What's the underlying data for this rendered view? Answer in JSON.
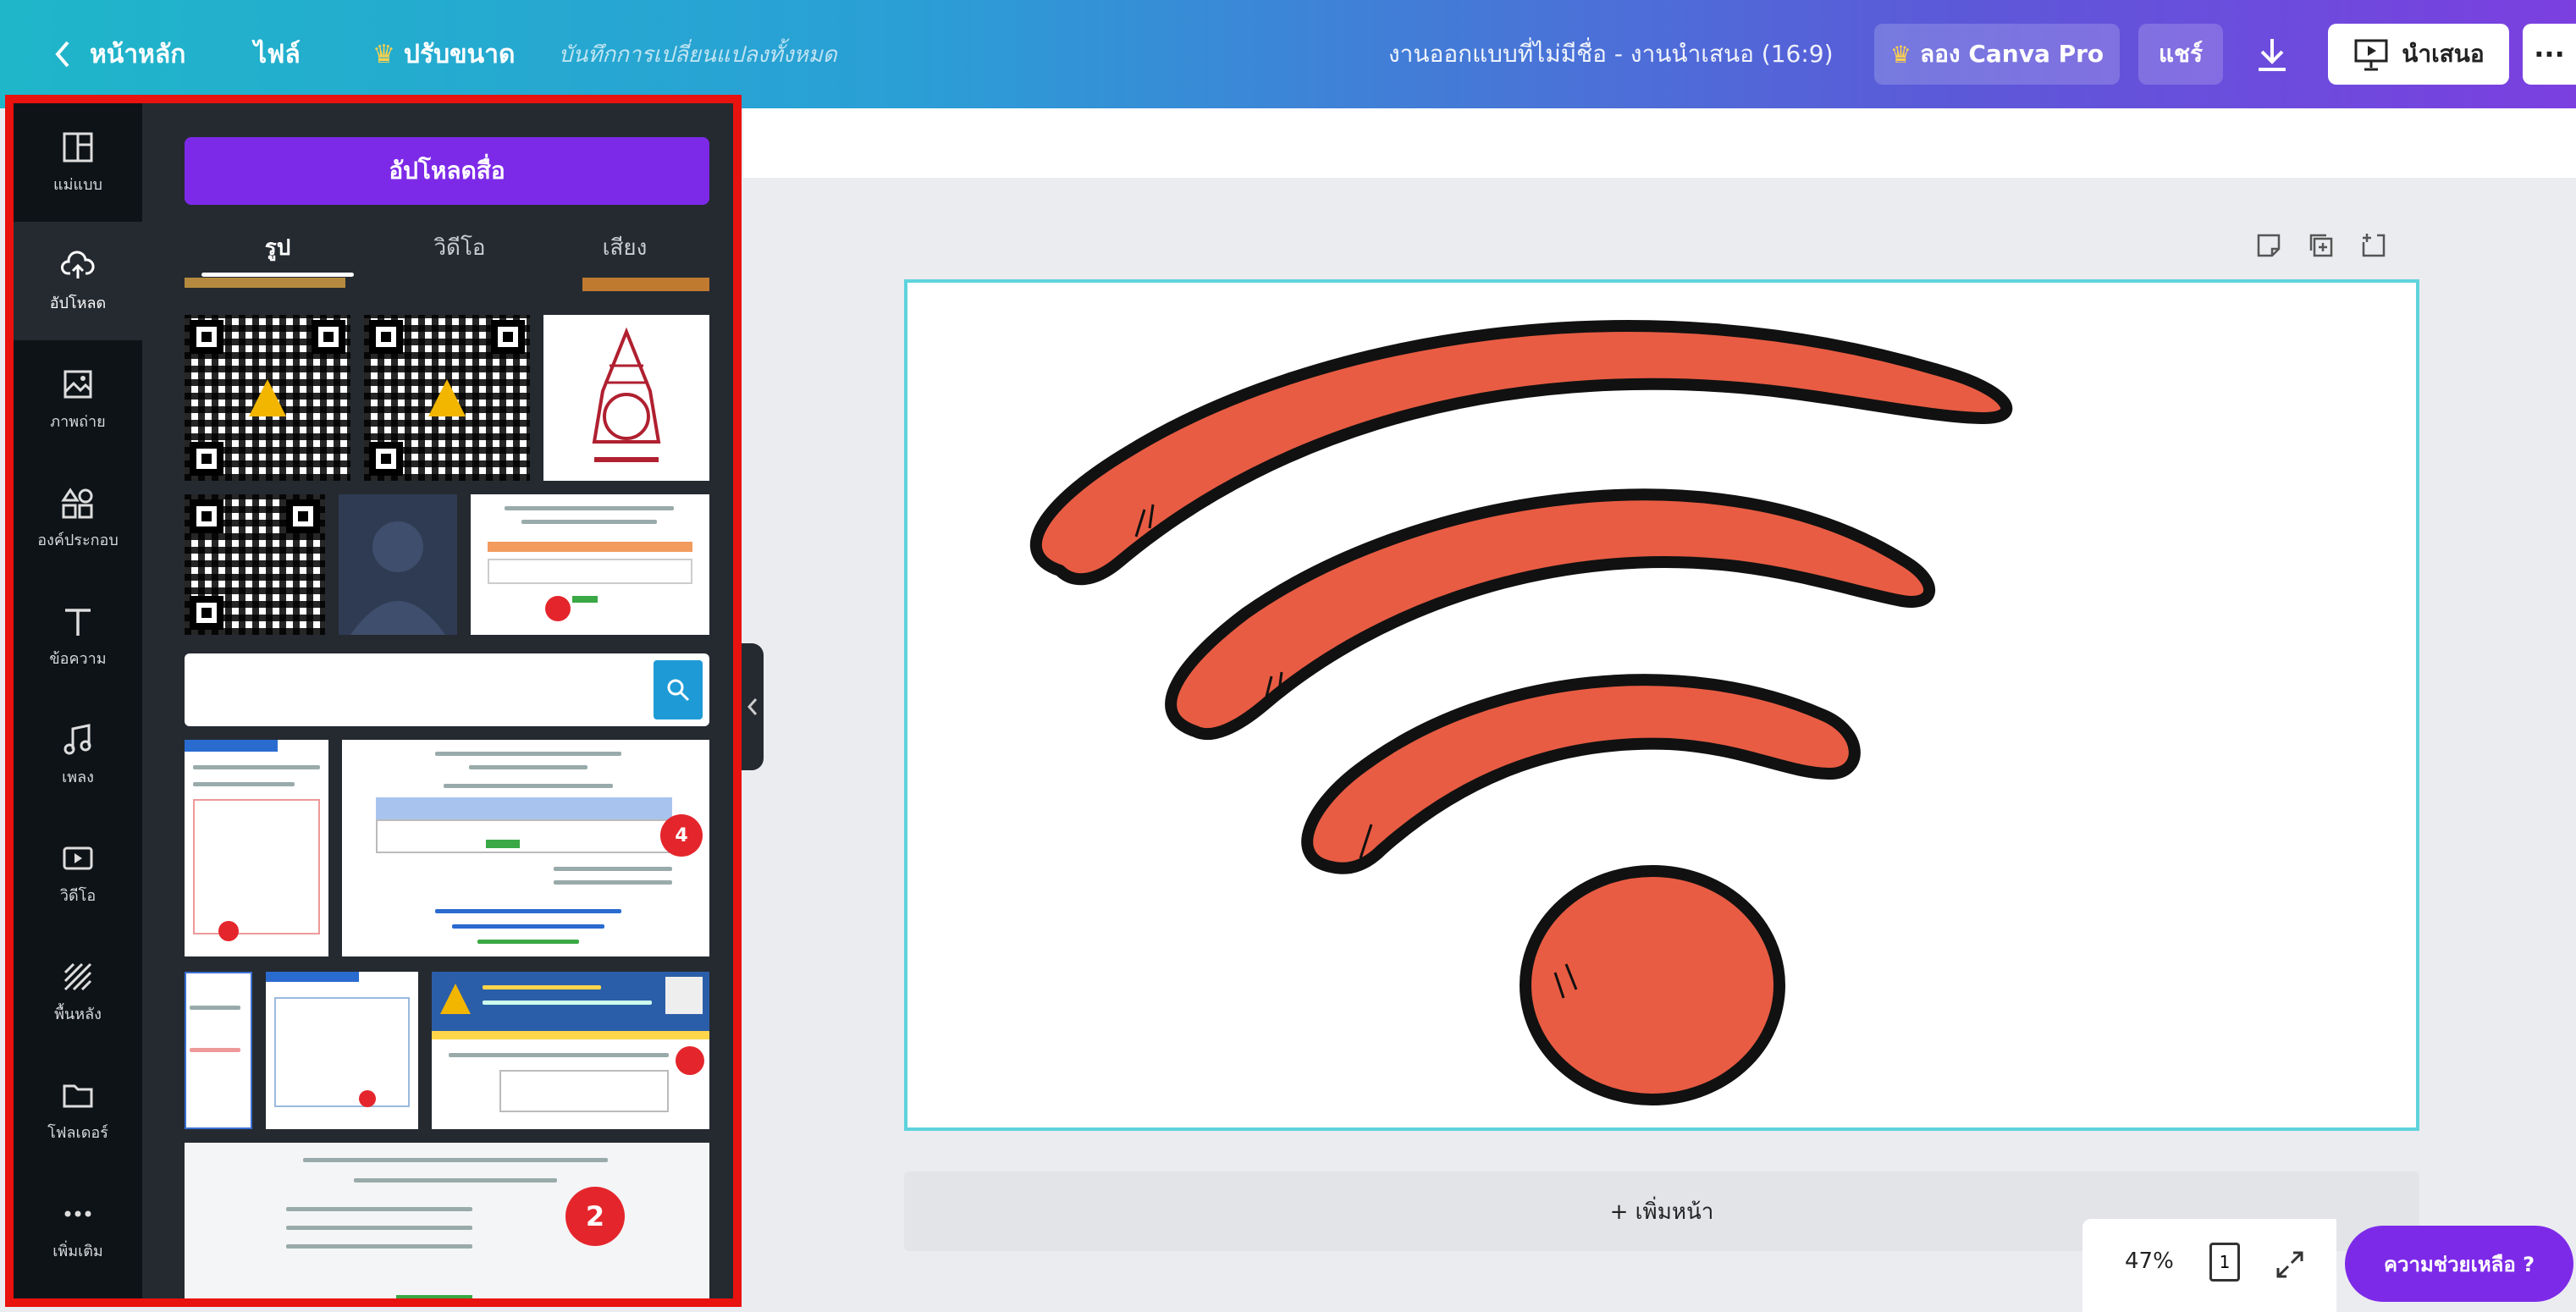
{
  "topbar": {
    "home_label": "หน้าหลัก",
    "file_label": "ไฟล์",
    "resize_label": "ปรับขนาด",
    "save_status": "บันทึกการเปลี่ยนแปลงทั้งหมด",
    "doc_title": "งานออกแบบที่ไม่มีชื่อ - งานนำเสนอ (16:9)",
    "try_pro_label": "ลอง Canva Pro",
    "share_label": "แชร์",
    "present_label": "นำเสนอ",
    "more_label": "···"
  },
  "rail": {
    "items": [
      {
        "label": "แม่แบบ",
        "icon": "template-icon"
      },
      {
        "label": "อัปโหลด",
        "icon": "upload-icon"
      },
      {
        "label": "ภาพถ่าย",
        "icon": "photo-icon"
      },
      {
        "label": "องค์ประกอบ",
        "icon": "elements-icon"
      },
      {
        "label": "ข้อความ",
        "icon": "text-icon"
      },
      {
        "label": "เพลง",
        "icon": "music-icon"
      },
      {
        "label": "วิดีโอ",
        "icon": "video-icon"
      },
      {
        "label": "พื้นหลัง",
        "icon": "background-icon"
      },
      {
        "label": "โฟลเดอร์",
        "icon": "folder-icon"
      },
      {
        "label": "เพิ่มเติม",
        "icon": "more-icon"
      }
    ]
  },
  "drawer": {
    "upload_button": "อัปโหลดสื่อ",
    "tabs": [
      "รูป",
      "วิดีโอ",
      "เสียง"
    ],
    "search_placeholder": "",
    "badges": [
      "4",
      "2"
    ]
  },
  "canvas": {
    "add_page_label": "+ เพิ่มหน้า",
    "zoom": "47%",
    "page_count": "1",
    "help_label": "ความช่วยเหลือ ?"
  },
  "colors": {
    "accent": "#7d2ae8",
    "wifi_fill": "#e85c43",
    "panel_border": "#e8120f"
  }
}
